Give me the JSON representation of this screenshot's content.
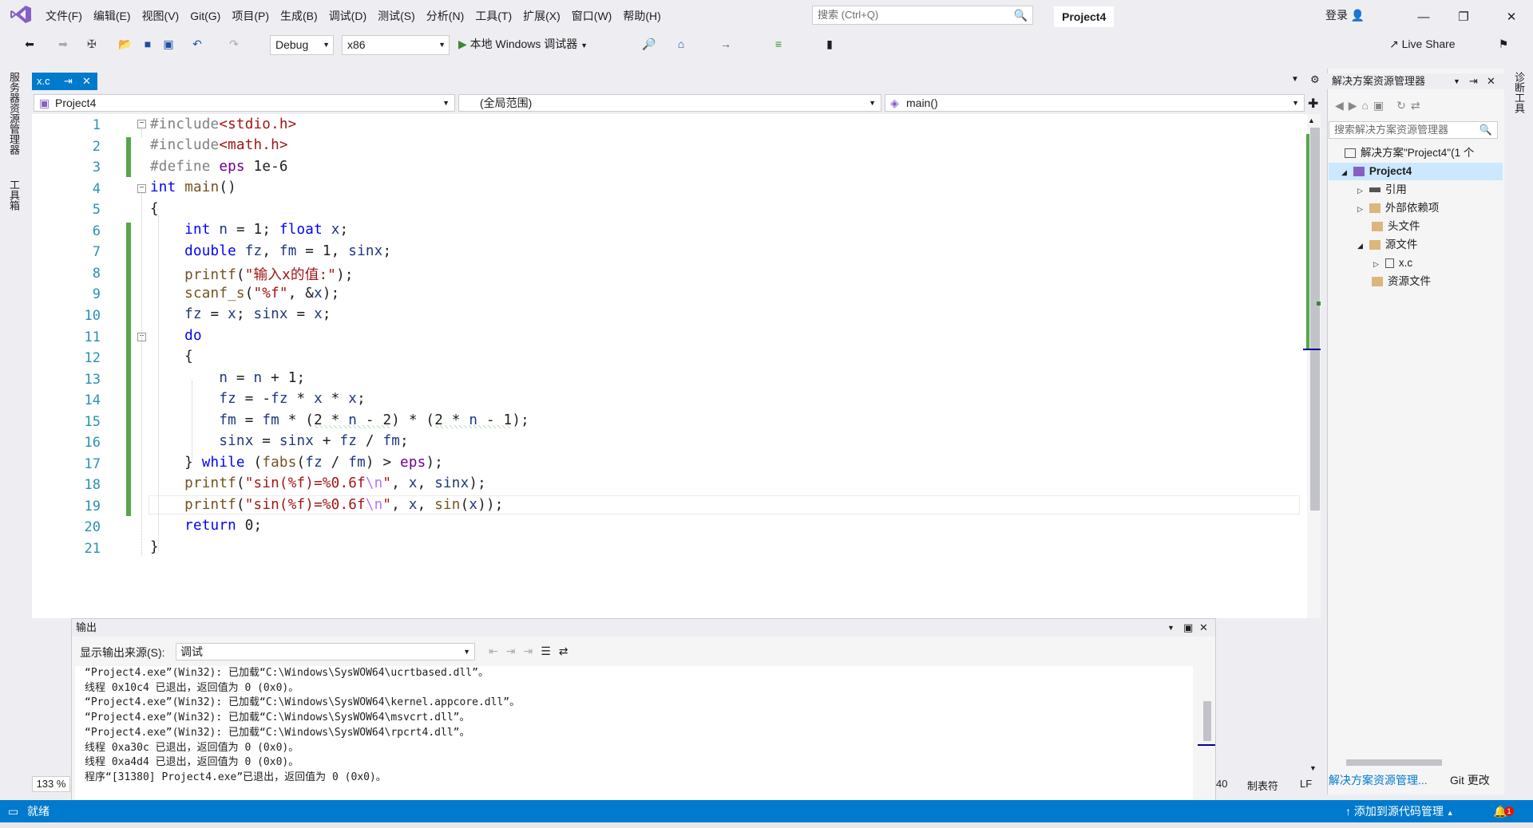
{
  "menu": [
    "文件(F)",
    "编辑(E)",
    "视图(V)",
    "Git(G)",
    "项目(P)",
    "生成(B)",
    "调试(D)",
    "测试(S)",
    "分析(N)",
    "工具(T)",
    "扩展(X)",
    "窗口(W)",
    "帮助(H)"
  ],
  "search_placeholder": "搜索 (Ctrl+Q)",
  "project_title": "Project4",
  "login": "登录",
  "live_share": "Live Share",
  "toolbar": {
    "config": "Debug",
    "platform": "x86",
    "run_label": "本地 Windows 调试器"
  },
  "left_tabs": [
    "服务器资源管理器",
    "工具箱"
  ],
  "right_tab": "诊断工具",
  "doc_tab": {
    "label": "x.c"
  },
  "nav": {
    "project": "Project4",
    "scope": "(全局范围)",
    "member": "main()"
  },
  "code_lines": [
    {
      "n": "1"
    },
    {
      "n": "2"
    },
    {
      "n": "3"
    },
    {
      "n": "4"
    },
    {
      "n": "5"
    },
    {
      "n": "6"
    },
    {
      "n": "7"
    },
    {
      "n": "8"
    },
    {
      "n": "9"
    },
    {
      "n": "10"
    },
    {
      "n": "11"
    },
    {
      "n": "12"
    },
    {
      "n": "13"
    },
    {
      "n": "14"
    },
    {
      "n": "15"
    },
    {
      "n": "16"
    },
    {
      "n": "17"
    },
    {
      "n": "18"
    },
    {
      "n": "19"
    },
    {
      "n": "20"
    },
    {
      "n": "21"
    }
  ],
  "solution": {
    "header": "解决方案资源管理器",
    "search": "搜索解决方案资源管理器",
    "items": [
      "解决方案\"Project4\"(1 个",
      "Project4",
      "引用",
      "外部依赖项",
      "头文件",
      "源文件",
      "x.c",
      "资源文件"
    ]
  },
  "output": {
    "title": "输出",
    "source_label": "显示输出来源(S):",
    "source_value": "调试",
    "lines": [
      "“Project4.exe”(Win32): 已加载“C:\\Windows\\SysWOW64\\ucrtbased.dll”。",
      "线程 0x10c4 已退出，返回值为 0 (0x0)。",
      "“Project4.exe”(Win32): 已加载“C:\\Windows\\SysWOW64\\kernel.appcore.dll”。",
      "“Project4.exe”(Win32): 已加载“C:\\Windows\\SysWOW64\\msvcrt.dll”。",
      "“Project4.exe”(Win32): 已加载“C:\\Windows\\SysWOW64\\rpcrt4.dll”。",
      "线程 0xa30c 已退出，返回值为 0 (0x0)。",
      "线程 0xa4d4 已退出，返回值为 0 (0x0)。",
      "程序“[31380] Project4.exe”已退出，返回值为 0 (0x0)。"
    ]
  },
  "zoom": "133 %",
  "status": {
    "ready": "就绪",
    "col": "40",
    "mode": "制表符",
    "eol": "LF",
    "add_source": "添加到源代码管理",
    "notif": "1"
  },
  "bottom_tabs": [
    "解决方案资源管理...",
    "Git 更改"
  ]
}
